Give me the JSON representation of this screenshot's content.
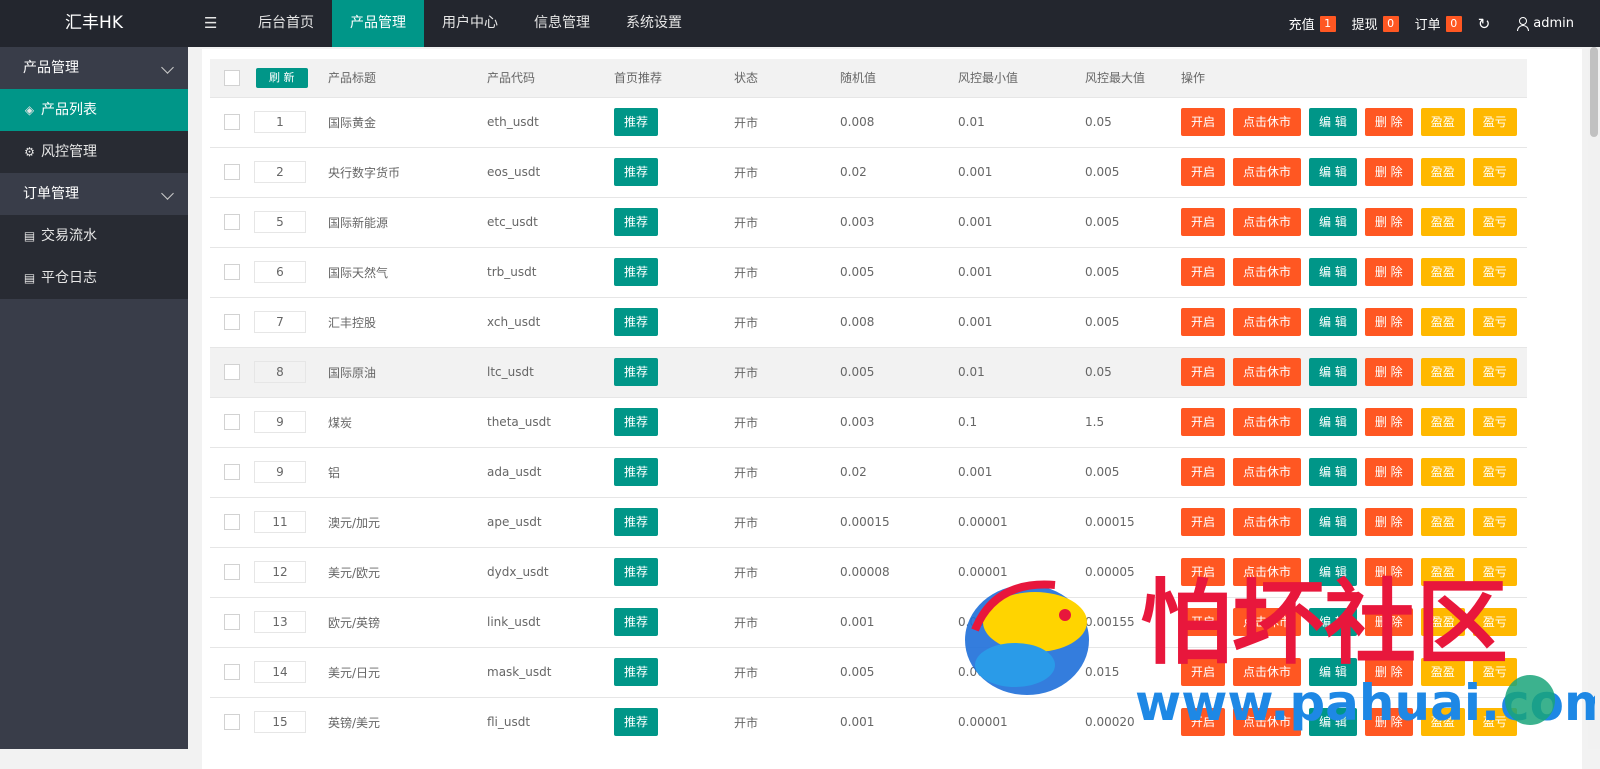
{
  "app": {
    "logo": "汇丰HK"
  },
  "topnav": {
    "items": [
      {
        "label": "后台首页"
      },
      {
        "label": "产品管理"
      },
      {
        "label": "用户中心"
      },
      {
        "label": "信息管理"
      },
      {
        "label": "系统设置"
      }
    ],
    "active": "产品管理"
  },
  "topright": {
    "recharge_label": "充值",
    "recharge_count": "1",
    "withdraw_label": "提现",
    "withdraw_count": "0",
    "order_label": "订单",
    "order_count": "0",
    "refresh_icon": "refresh-icon",
    "user": "admin"
  },
  "sidebar": {
    "group1": "产品管理",
    "items1": [
      {
        "label": "产品列表",
        "icon": "layers-icon"
      },
      {
        "label": "风控管理",
        "icon": "gear-icon"
      }
    ],
    "group2": "订单管理",
    "items2": [
      {
        "label": "交易流水",
        "icon": "doc-icon"
      },
      {
        "label": "平仓日志",
        "icon": "doc-icon"
      }
    ]
  },
  "table": {
    "refresh": "刷 新",
    "headers": [
      "产品标题",
      "产品代码",
      "首页推荐",
      "状态",
      "随机值",
      "风控最小值",
      "风控最大值",
      "操作"
    ],
    "rec_label": "推荐",
    "actions": [
      "开启",
      "点击休市",
      "编 辑",
      "删 除",
      "盈盈",
      "盈亏"
    ],
    "rows": [
      {
        "sort": "1",
        "title": "国际黄金",
        "code": "eth_usdt",
        "status": "开市",
        "rand": "0.008",
        "min": "0.01",
        "max": "0.05"
      },
      {
        "sort": "2",
        "title": "央行数字货币",
        "code": "eos_usdt",
        "status": "开市",
        "rand": "0.02",
        "min": "0.001",
        "max": "0.005"
      },
      {
        "sort": "5",
        "title": "国际新能源",
        "code": "etc_usdt",
        "status": "开市",
        "rand": "0.003",
        "min": "0.001",
        "max": "0.005"
      },
      {
        "sort": "6",
        "title": "国际天然气",
        "code": "trb_usdt",
        "status": "开市",
        "rand": "0.005",
        "min": "0.001",
        "max": "0.005"
      },
      {
        "sort": "7",
        "title": "汇丰控股",
        "code": "xch_usdt",
        "status": "开市",
        "rand": "0.008",
        "min": "0.001",
        "max": "0.005"
      },
      {
        "sort": "8",
        "title": "国际原油",
        "code": "ltc_usdt",
        "status": "开市",
        "rand": "0.005",
        "min": "0.01",
        "max": "0.05"
      },
      {
        "sort": "9",
        "title": "煤炭",
        "code": "theta_usdt",
        "status": "开市",
        "rand": "0.003",
        "min": "0.1",
        "max": "1.5"
      },
      {
        "sort": "9",
        "title": "铝",
        "code": "ada_usdt",
        "status": "开市",
        "rand": "0.02",
        "min": "0.001",
        "max": "0.005"
      },
      {
        "sort": "11",
        "title": "澳元/加元",
        "code": "ape_usdt",
        "status": "开市",
        "rand": "0.00015",
        "min": "0.00001",
        "max": "0.00015"
      },
      {
        "sort": "12",
        "title": "美元/欧元",
        "code": "dydx_usdt",
        "status": "开市",
        "rand": "0.00008",
        "min": "0.00001",
        "max": "0.00005"
      },
      {
        "sort": "13",
        "title": "欧元/英镑",
        "code": "link_usdt",
        "status": "开市",
        "rand": "0.001",
        "min": "0.00001",
        "max": "0.00155"
      },
      {
        "sort": "14",
        "title": "美元/日元",
        "code": "mask_usdt",
        "status": "开市",
        "rand": "0.005",
        "min": "0.001",
        "max": "0.015"
      },
      {
        "sort": "15",
        "title": "英镑/美元",
        "code": "fli_usdt",
        "status": "开市",
        "rand": "0.001",
        "min": "0.00001",
        "max": "0.00020"
      }
    ]
  },
  "watermark": {
    "title": "怕坏社区",
    "url": "www.pahuai.com"
  },
  "colors": {
    "accent": "#009688",
    "danger": "#ff5722",
    "warn": "#ffb800",
    "header": "#23262e",
    "sidebar": "#393d49"
  }
}
